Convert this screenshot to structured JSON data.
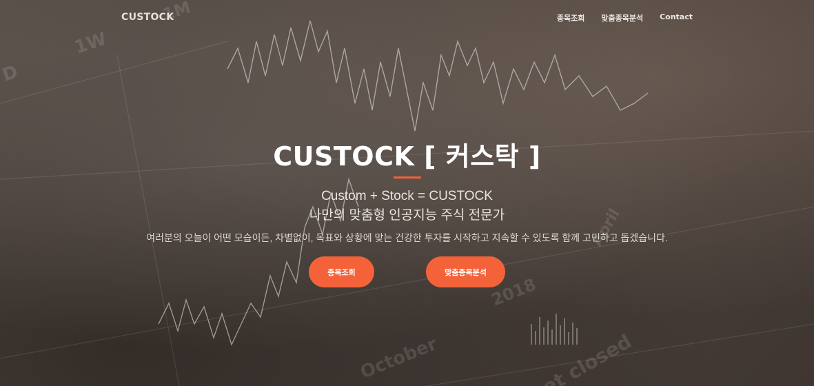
{
  "navbar": {
    "brand": "CUSTOCK",
    "links": [
      "종목조회",
      "맞춤종목분석",
      "Contact"
    ]
  },
  "hero": {
    "title": "CUSTOCK [ 커스탁 ]",
    "subtitle_line1": "Custom + Stock = CUSTOCK",
    "subtitle_line2": "나만의 맞춤형 인공지능 주식 전문가",
    "description": "여러분의 오늘이 어떤 모습이든, 차별없이, 목표와 상황에 맞는 건강한 투자를 시작하고 지속할 수 있도록 함께 고민하고 돕겠습니다.",
    "buttons": [
      "종목조회",
      "맞춤종목분석"
    ]
  },
  "background": {
    "texts": [
      "1W",
      "1M",
      "D",
      "April",
      "2018",
      "October",
      "et closed"
    ]
  },
  "colors": {
    "accent": "#f4623a",
    "text": "#ffffff"
  }
}
